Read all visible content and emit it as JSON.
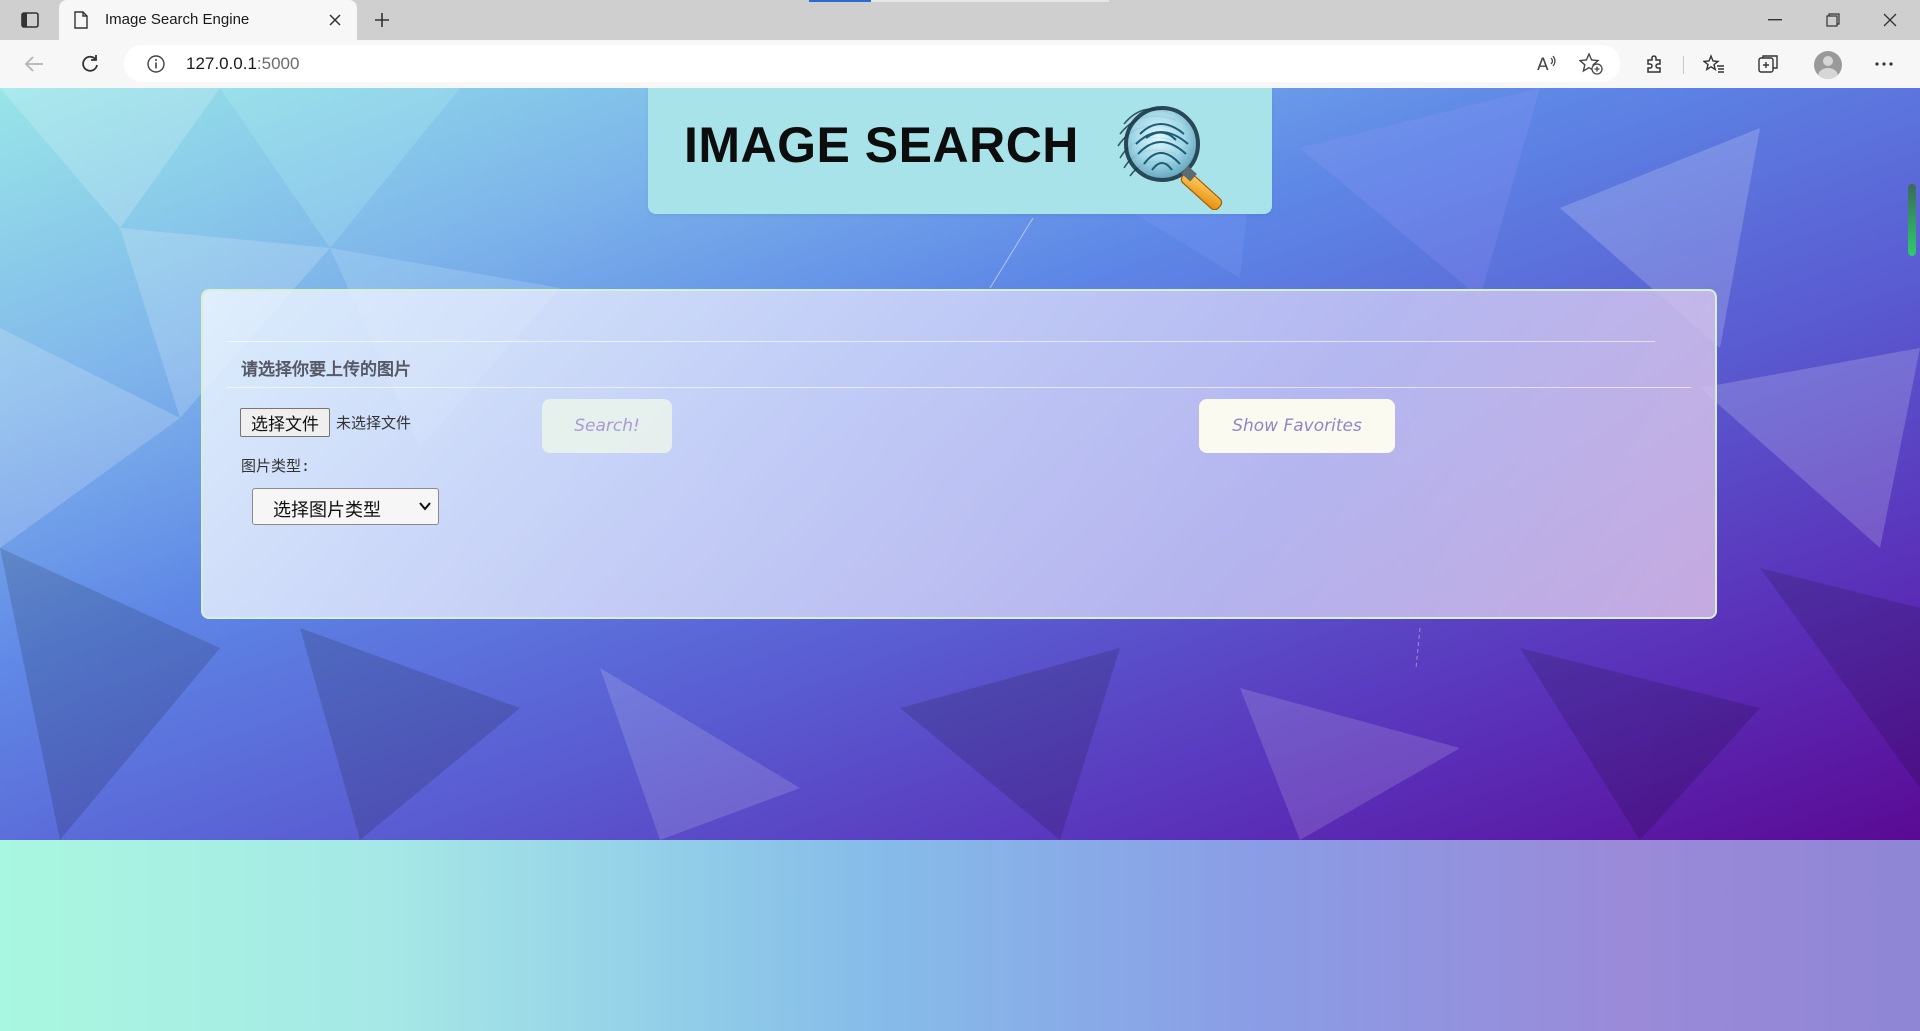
{
  "browser": {
    "tab_title": "Image Search Engine",
    "url_host": "127.0.0.1",
    "url_port": ":5000",
    "icons": {
      "sidebar": "tab-sidebar-icon",
      "page": "page-icon",
      "close": "close-icon",
      "new_tab": "plus-icon",
      "back": "back-arrow-icon",
      "reload": "reload-icon",
      "info": "info-icon",
      "read_aloud": "read-aloud-icon",
      "add_favorite": "star-add-icon",
      "extensions": "puzzle-icon",
      "favorites": "favorites-list-icon",
      "collections": "collections-icon",
      "profile": "avatar",
      "more": "more-icon",
      "minimize": "minimize-icon",
      "restore": "restore-icon",
      "window_close": "close-icon"
    }
  },
  "page": {
    "banner_title": "IMAGE SEARCH",
    "panel": {
      "heading": "请选择你要上传的图片",
      "file_button_label": "选择文件",
      "file_status": "未选择文件",
      "search_button_label": "Search!",
      "favorites_button_label": "Show Favorites",
      "type_label": "图片类型:",
      "type_select_value": "选择图片类型"
    }
  },
  "colors": {
    "banner_bg": "#a8e3ea",
    "button_text": "#a99ad6",
    "scroll_accent": "#2ecb6c"
  }
}
